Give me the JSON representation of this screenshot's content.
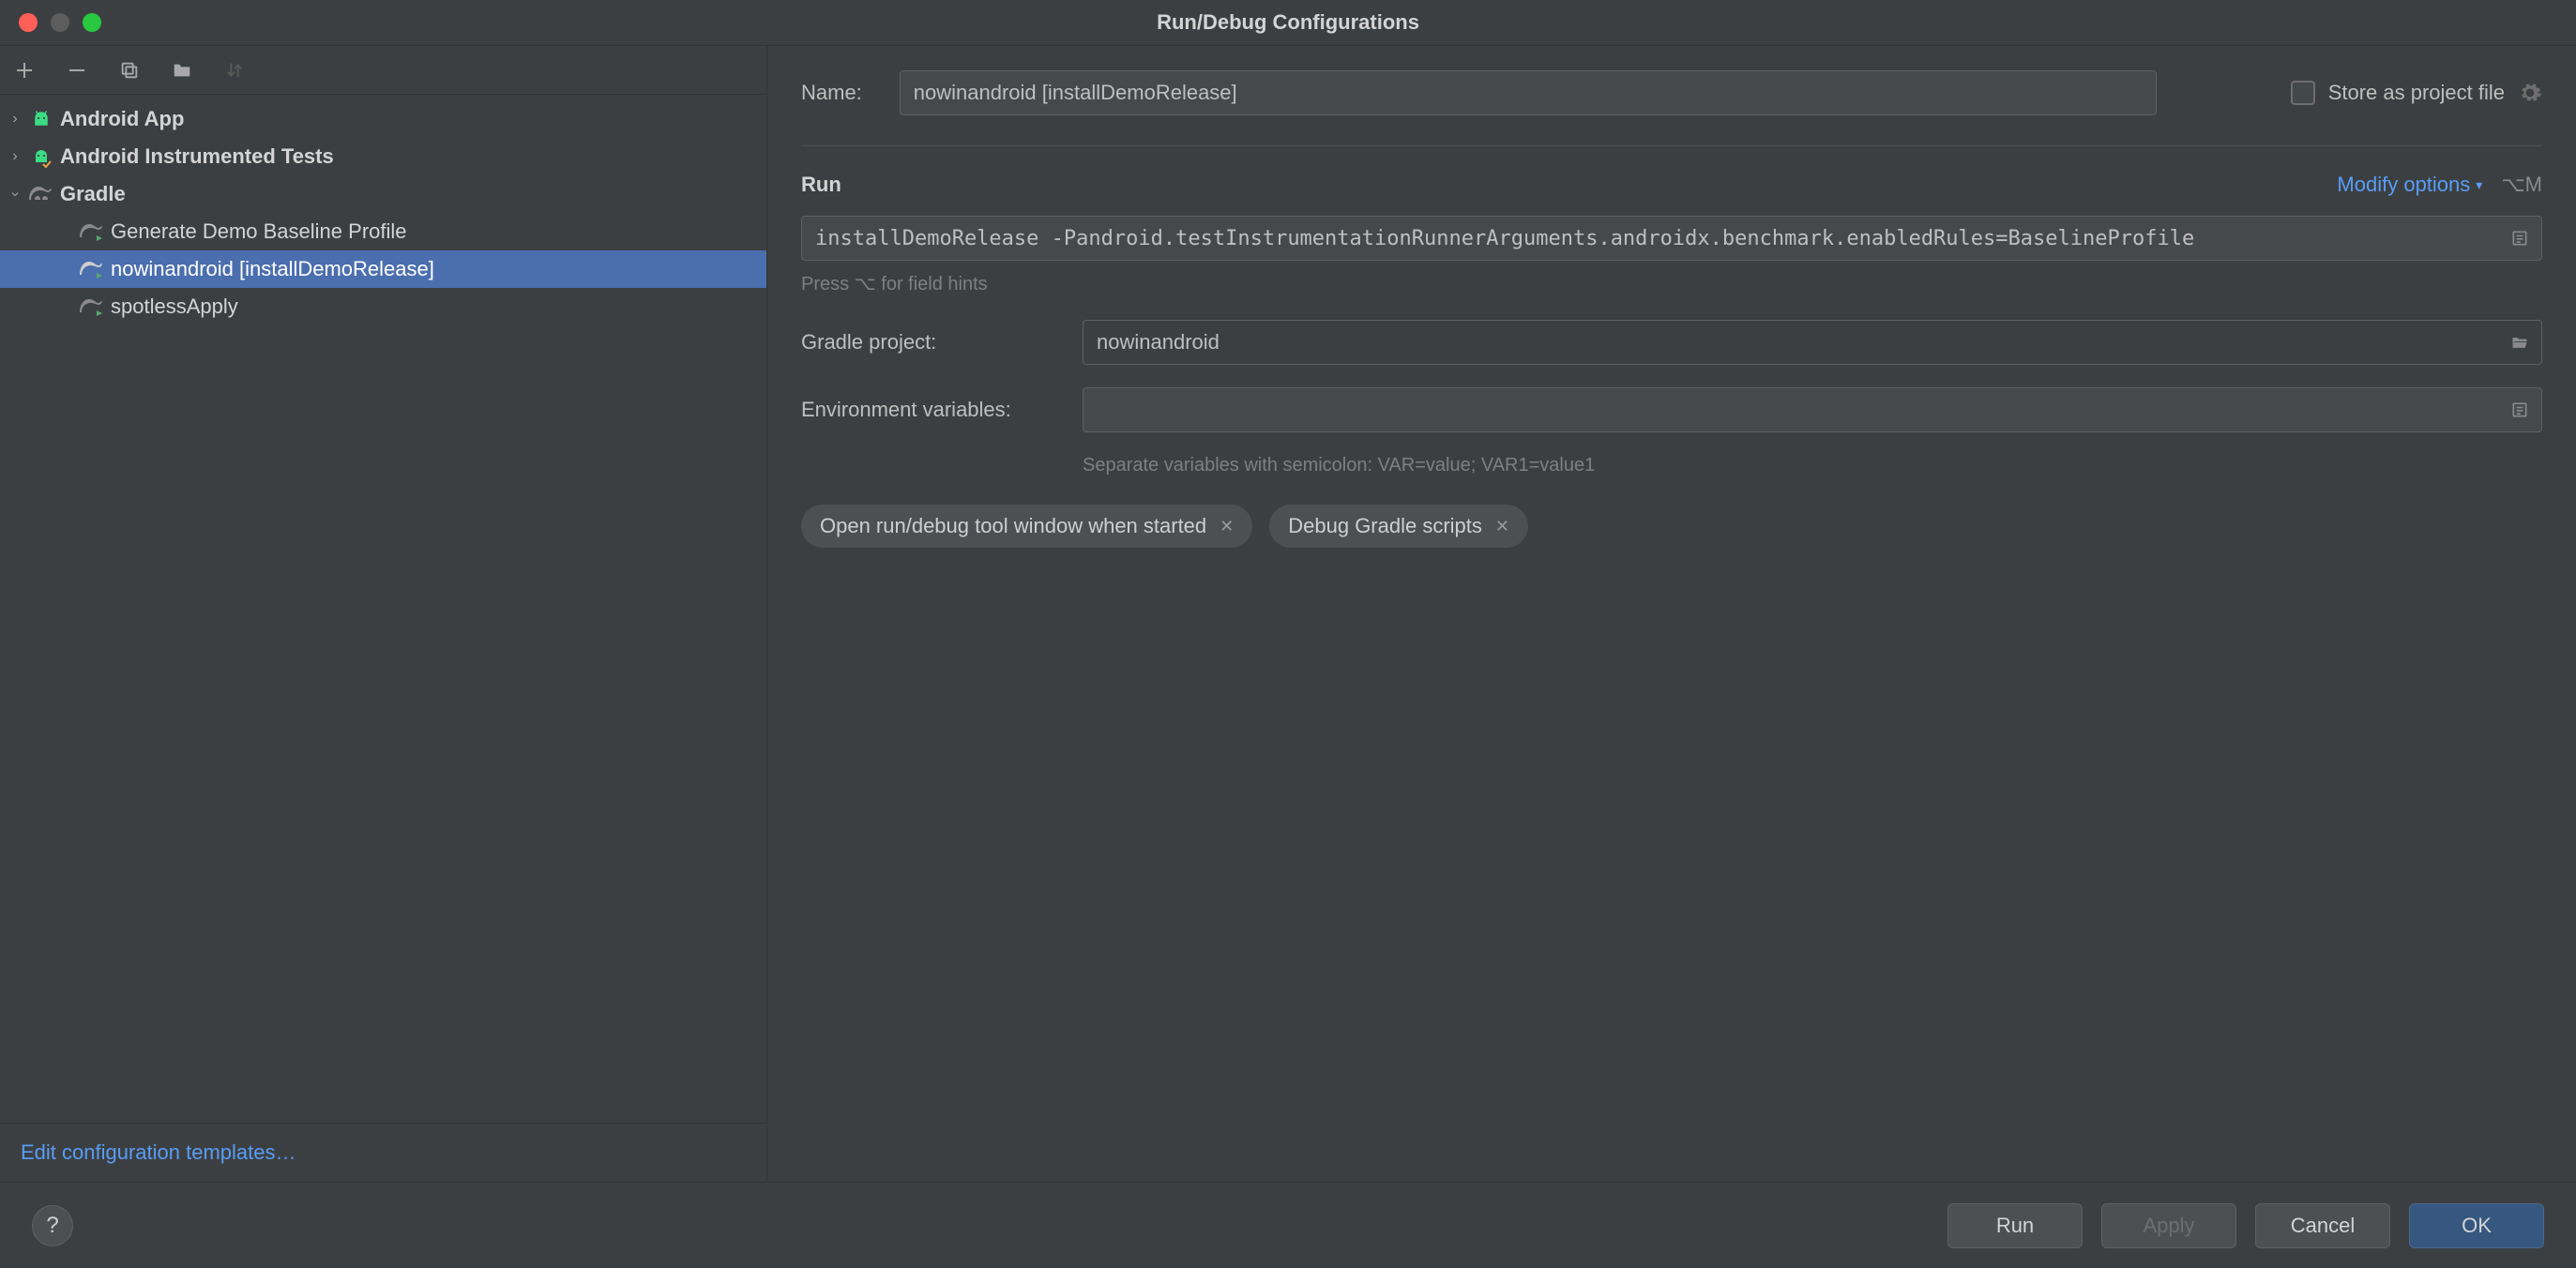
{
  "window": {
    "title": "Run/Debug Configurations"
  },
  "toolbar": {
    "add_tip": "Add",
    "remove_tip": "Remove",
    "copy_tip": "Copy",
    "folder_tip": "Create folder",
    "sort_tip": "Sort"
  },
  "tree": [
    {
      "label": "Android App",
      "icon": "android",
      "bold": true,
      "expanded": false,
      "level": 0
    },
    {
      "label": "Android Instrumented Tests",
      "icon": "android-test",
      "bold": true,
      "expanded": false,
      "level": 0
    },
    {
      "label": "Gradle",
      "icon": "gradle",
      "bold": true,
      "expanded": true,
      "level": 0
    },
    {
      "label": "Generate Demo Baseline Profile",
      "icon": "gradle-run",
      "level": 1
    },
    {
      "label": "nowinandroid [installDemoRelease]",
      "icon": "gradle-run",
      "level": 1,
      "selected": true
    },
    {
      "label": "spotlessApply",
      "icon": "gradle-run",
      "level": 1
    }
  ],
  "left_footer": {
    "edit_templates": "Edit configuration templates…"
  },
  "form": {
    "name_label": "Name:",
    "name_value": "nowinandroid [installDemoRelease]",
    "store_as_file_label": "Store as project file",
    "run_section": "Run",
    "modify_options": "Modify options",
    "modify_shortcut": "⌥M",
    "command_value": "installDemoRelease -Pandroid.testInstrumentationRunnerArguments.androidx.benchmark.enabledRules=BaselineProfile",
    "field_hint": "Press ⌥ for field hints",
    "gradle_project_label": "Gradle project:",
    "gradle_project_value": "nowinandroid",
    "env_vars_label": "Environment variables:",
    "env_vars_value": "",
    "env_hint": "Separate variables with semicolon: VAR=value; VAR1=value1",
    "chip_open_tool": "Open run/debug tool window when started",
    "chip_debug_gradle": "Debug Gradle scripts"
  },
  "buttons": {
    "help": "?",
    "run": "Run",
    "apply": "Apply",
    "cancel": "Cancel",
    "ok": "OK"
  }
}
